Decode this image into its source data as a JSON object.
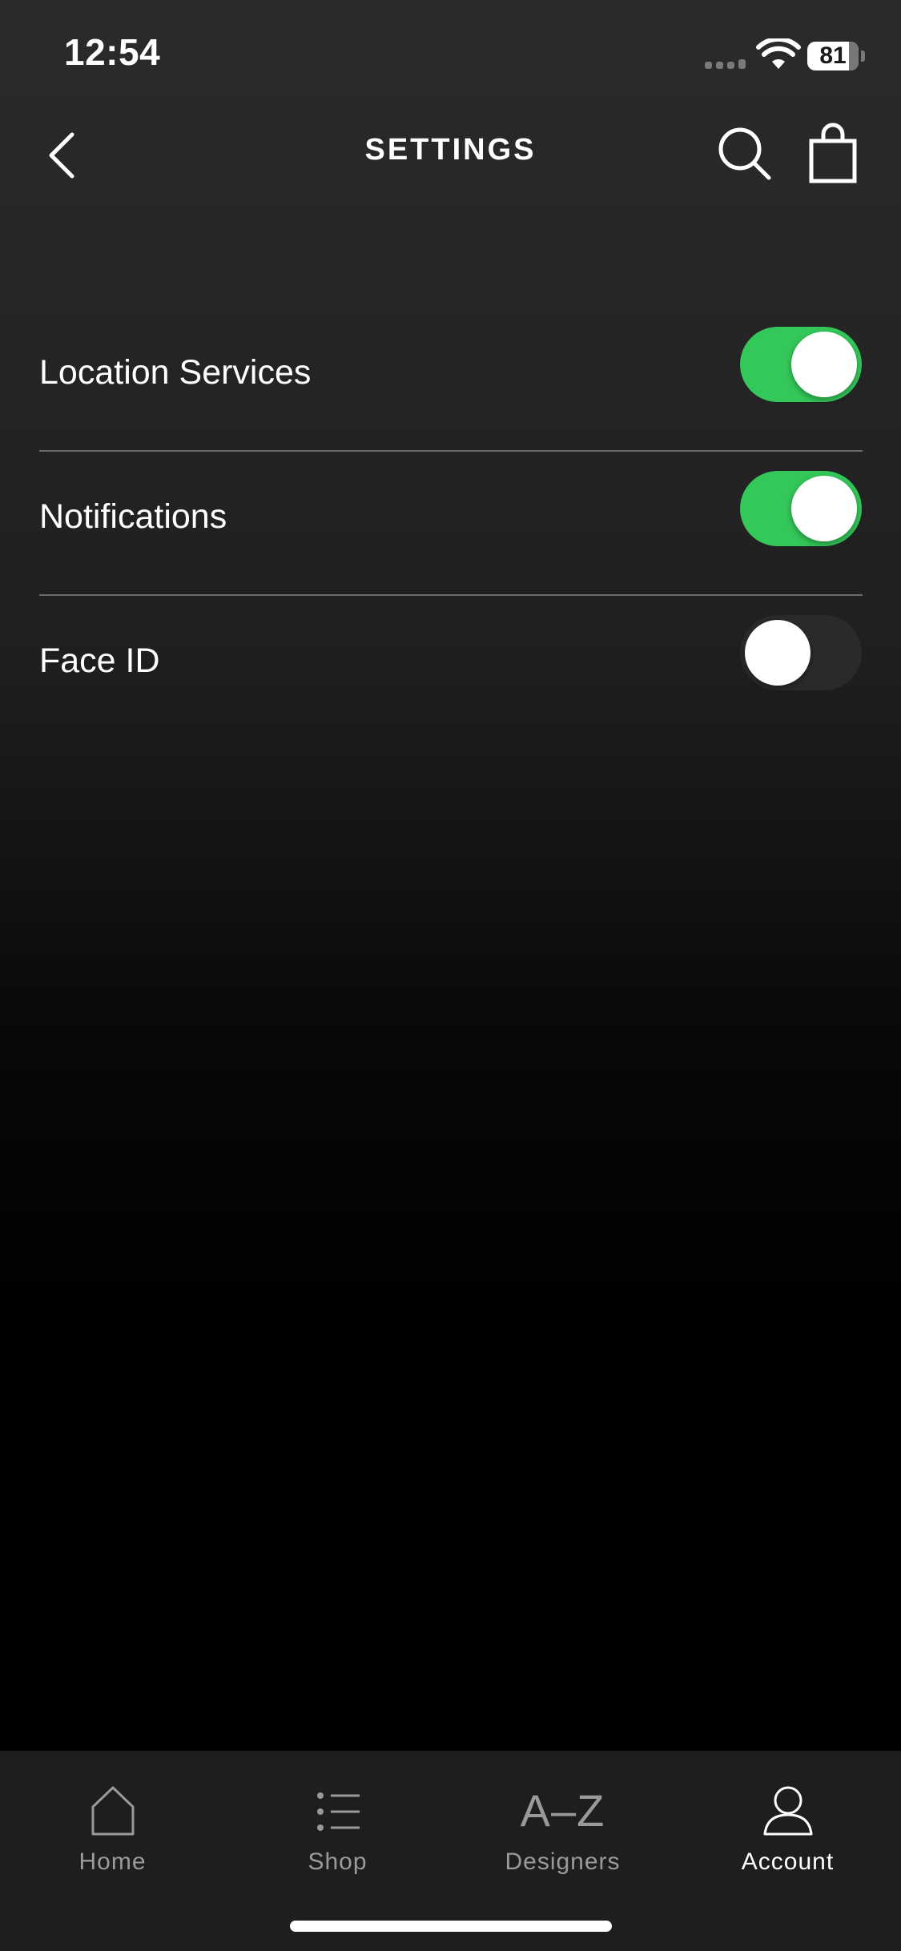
{
  "status_bar": {
    "time": "12:54",
    "battery_level": "81",
    "battery_fraction": 0.81
  },
  "header": {
    "title": "SETTINGS",
    "back_icon": "chevron-left-icon",
    "search_icon": "search-icon",
    "bag_icon": "shopping-bag-icon"
  },
  "settings": {
    "items": [
      {
        "label": "Location Services",
        "enabled": true
      },
      {
        "label": "Notifications",
        "enabled": true
      },
      {
        "label": "Face ID",
        "enabled": false
      }
    ]
  },
  "tab_bar": {
    "items": [
      {
        "label": "Home",
        "icon": "home-icon",
        "active": false
      },
      {
        "label": "Shop",
        "icon": "list-icon",
        "active": false
      },
      {
        "label": "Designers",
        "icon": "a-z-icon",
        "glyph": "A–Z",
        "active": false
      },
      {
        "label": "Account",
        "icon": "person-icon",
        "active": true
      }
    ]
  },
  "colors": {
    "toggle_on": "#34c759",
    "toggle_off": "#2a2a2c",
    "text_primary": "#ffffff",
    "tab_inactive": "#9a9a9a"
  }
}
